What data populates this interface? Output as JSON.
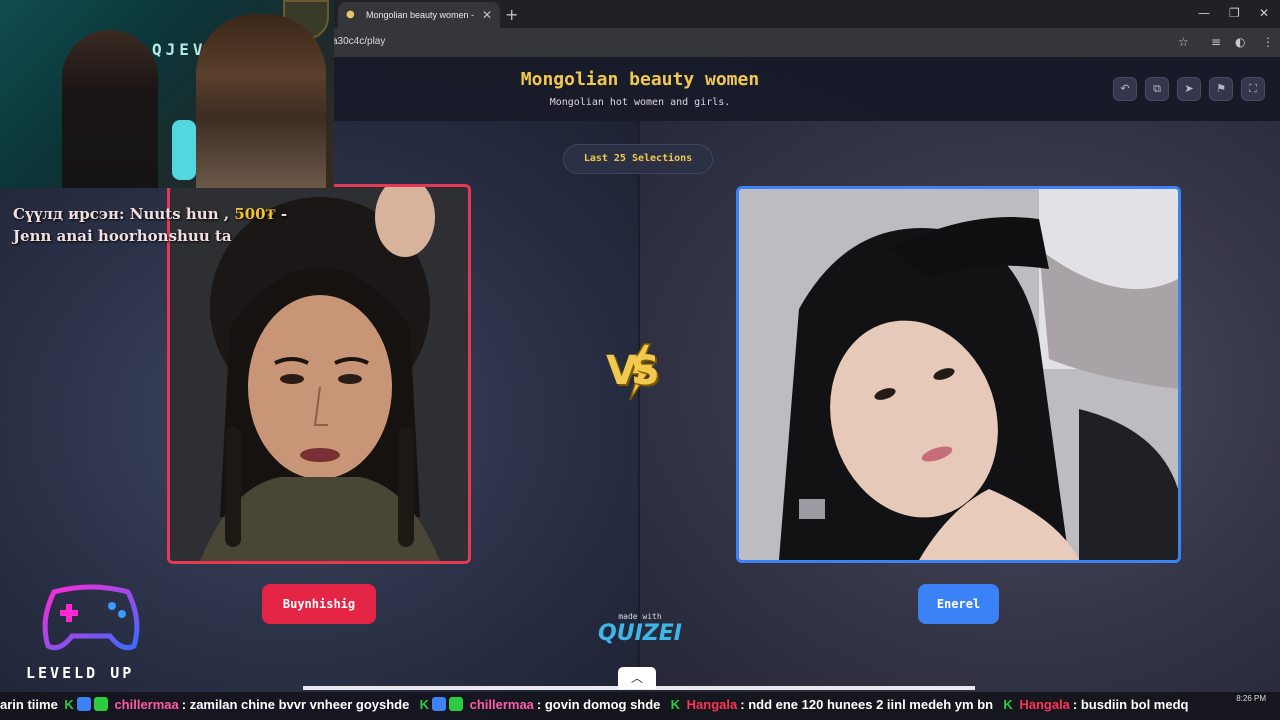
{
  "browser": {
    "tab_title": "Mongolian beauty women - Ti",
    "url": "a30c4c/play",
    "new_tab": "+",
    "tab_close": "✕"
  },
  "game": {
    "title": "Mongolian beauty women",
    "subtitle": "Mongolian hot women and girls.",
    "last_selections": "Last 25 Selections",
    "vs": "VS",
    "left_choice": "Buynhishig",
    "right_choice": "Enerel",
    "made_with": "made with",
    "brand": "QUIZEI",
    "header_icons": [
      "undo-icon",
      "share-icon",
      "send-icon",
      "flag-icon",
      "fullscreen-icon"
    ]
  },
  "stream": {
    "webcam_sign": "QJEV",
    "alert_line1_prefix": "Сүүлд ирсэн: Nuuts hun ,",
    "alert_amount": "500₮",
    "alert_line1_suffix": "-",
    "alert_line2": "Jenn anai hoorhonshuu ta",
    "logo_text": "LEVELD UP",
    "chat": [
      {
        "name": "",
        "text": "arin tiime"
      },
      {
        "name": "chillermaa",
        "text": ": zamilan chine bvvr vnheer goyshde"
      },
      {
        "name": "chillermaa",
        "text": ": govin domog shde"
      },
      {
        "name": "Hangala",
        "text": ": ndd ene 120 hunees 2 iinl medeh ym bn"
      },
      {
        "name": "Hangala",
        "text": ": busdiin bol medq"
      }
    ],
    "clock": "8:26 PM"
  },
  "colors": {
    "accent_yellow": "#f2c94c",
    "left_red": "#e52545",
    "right_blue": "#3b82f6"
  }
}
